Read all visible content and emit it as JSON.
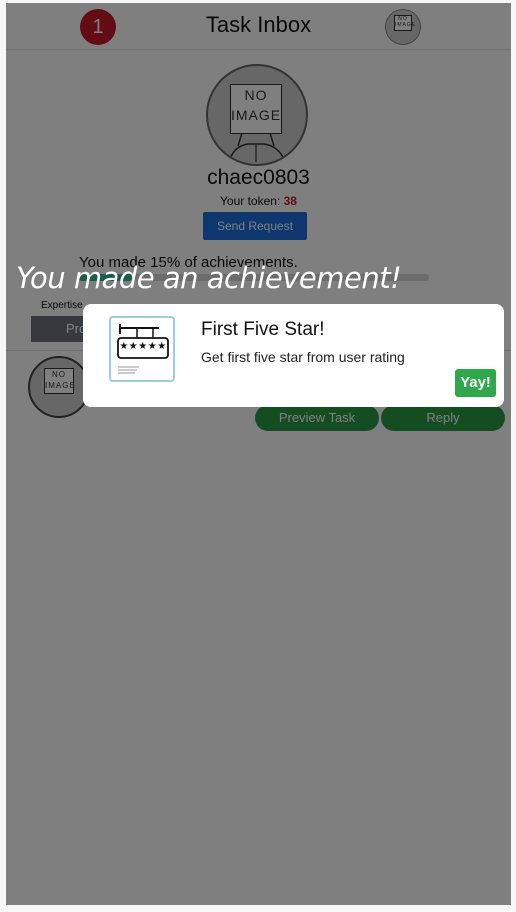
{
  "header": {
    "notification_count": "1",
    "title": "Task Inbox",
    "avatar_text_1": "NO",
    "avatar_text_2": "IMAGE"
  },
  "profile": {
    "avatar_text_1": "NO",
    "avatar_text_2": "IMAGE",
    "username": "chaec0803",
    "token_label": "Your token:",
    "token_value": "38",
    "send_request_label": "Send Request",
    "achievement_text": "You made 15% of achievements.",
    "achievement_progress": 0.15,
    "expertise_label": "Expertise",
    "profile_button_label": "Pro"
  },
  "task": {
    "avatar_text_1": "NO",
    "avatar_text_2": "IMAGE",
    "preview_label": "Preview Task",
    "reply_label": "Reply"
  },
  "achievement_popup": {
    "banner": "You made an achievement!",
    "title": "First Five Star!",
    "description": "Get first five star from user rating",
    "badge_stars": "★★★★★",
    "confirm_label": "Yay!"
  },
  "colors": {
    "badge_red": "#c9182a",
    "primary_blue": "#1a6fdc",
    "success_green": "#2a9a47",
    "progress_green": "#2fbf8f"
  }
}
